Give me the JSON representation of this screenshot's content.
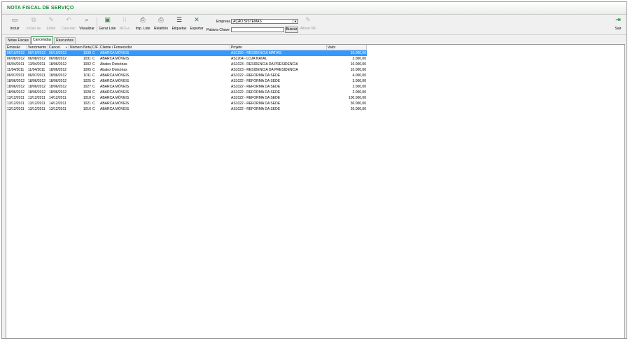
{
  "window": {
    "title": "NOTA FISCAL DE SERVIÇO"
  },
  "toolbar": {
    "buttons": [
      {
        "label": "Incluir",
        "icon": "document-icon",
        "enabled": true
      },
      {
        "label": "Incluir de",
        "icon": "copy-icon",
        "enabled": false
      },
      {
        "label": "Editar",
        "icon": "edit-icon",
        "enabled": false
      },
      {
        "label": "Cancelar",
        "icon": "cancel-icon",
        "enabled": false
      },
      {
        "label": "Visualizar",
        "icon": "magnifier-icon",
        "enabled": true
      },
      {
        "label": "Gerar Lote",
        "icon": "batch-icon",
        "enabled": true
      },
      {
        "label": "NFS-e",
        "icon": "nfse-icon",
        "enabled": false
      },
      {
        "label": "Imp. Lote",
        "icon": "import-icon",
        "enabled": true
      },
      {
        "label": "Relatório",
        "icon": "printer-icon",
        "enabled": true
      },
      {
        "label": "Etiquetas",
        "icon": "labels-icon",
        "enabled": true
      },
      {
        "label": "Exportar",
        "icon": "excel-icon",
        "enabled": true
      }
    ],
    "empresa_label": "Empresa",
    "empresa_value": "AÇÃO SISTEMAS",
    "palavra_chave_label": "Palavra Chave",
    "palavra_chave_value": "",
    "buscar_label": "Buscar",
    "alterar_nf_label": "Alterar NF",
    "sair_label": "Sair"
  },
  "tabs": [
    "Notas Fiscais",
    "Canceladas",
    "Rascunhos"
  ],
  "active_tab": "Canceladas",
  "grid": {
    "columns": [
      "Emissão",
      "Vencimento",
      "Cancel.",
      "Número Nota",
      "C/F",
      "Cliente / Fornecedor",
      "Projeto",
      "Valor"
    ],
    "rows": [
      [
        "06/10/2012",
        "06/10/2012",
        "06/10/2012",
        "1038",
        "C",
        "ABARCA MÓVEIS",
        "AS1250 - RESIDENCIA MATIAS",
        "10.000,00"
      ],
      [
        "06/08/2012",
        "06/08/2012",
        "06/08/2012",
        "1031",
        "C",
        "ABARCA MÓVEIS",
        "AS1204 - LOJA NATAL",
        "3.000,00"
      ],
      [
        "06/04/2011",
        "13/04/2011",
        "18/06/2012",
        "1002",
        "C",
        "Abatex Divisórias",
        "AS1023 - RESIDENCIA DA PRESIDENCIA",
        "10.000,00"
      ],
      [
        "11/04/2011",
        "11/04/2011",
        "18/06/2012",
        "1005",
        "C",
        "Abatex Divisórias",
        "AS1023 - RESIDENCIA DA PRESIDENCIA",
        "10.000,00"
      ],
      [
        "06/07/2011",
        "06/07/2011",
        "18/06/2012",
        "1011",
        "C",
        "ABARCA MÓVEIS",
        "AS1022 - REFORMA DA SEDE",
        "4.000,00"
      ],
      [
        "18/06/2012",
        "18/06/2012",
        "18/06/2012",
        "1025",
        "C",
        "ABARCA MÓVEIS",
        "AS1022 - REFORMA DA SEDE",
        "3.000,00"
      ],
      [
        "18/06/2012",
        "18/06/2012",
        "18/06/2012",
        "1027",
        "C",
        "ABARCA MÓVEIS",
        "AS1022 - REFORMA DA SEDE",
        "2.000,00"
      ],
      [
        "18/06/2012",
        "18/06/2012",
        "18/06/2012",
        "1028",
        "C",
        "ABARCA MÓVEIS",
        "AS1022 - REFORMA DA SEDE",
        "2.000,00"
      ],
      [
        "13/12/2011",
        "13/12/2011",
        "14/12/2011",
        "1018",
        "C",
        "ABARCA MÓVEIS",
        "AS1022 - REFORMA DA SEDE",
        "100.000,00"
      ],
      [
        "13/12/2011",
        "13/12/2011",
        "14/12/2011",
        "1021",
        "C",
        "ABARCA MÓVEIS",
        "AS1022 - REFORMA DA SEDE",
        "30.000,00"
      ],
      [
        "13/12/2011",
        "13/12/2011",
        "13/12/2011",
        "1016",
        "C",
        "ABARCA MÓVEIS",
        "AS1022 - REFORMA DA SEDE",
        "20.000,00"
      ]
    ],
    "selected_row": 0,
    "colors": {
      "selection": "#3399ff",
      "title": "#1e8a3c"
    }
  }
}
